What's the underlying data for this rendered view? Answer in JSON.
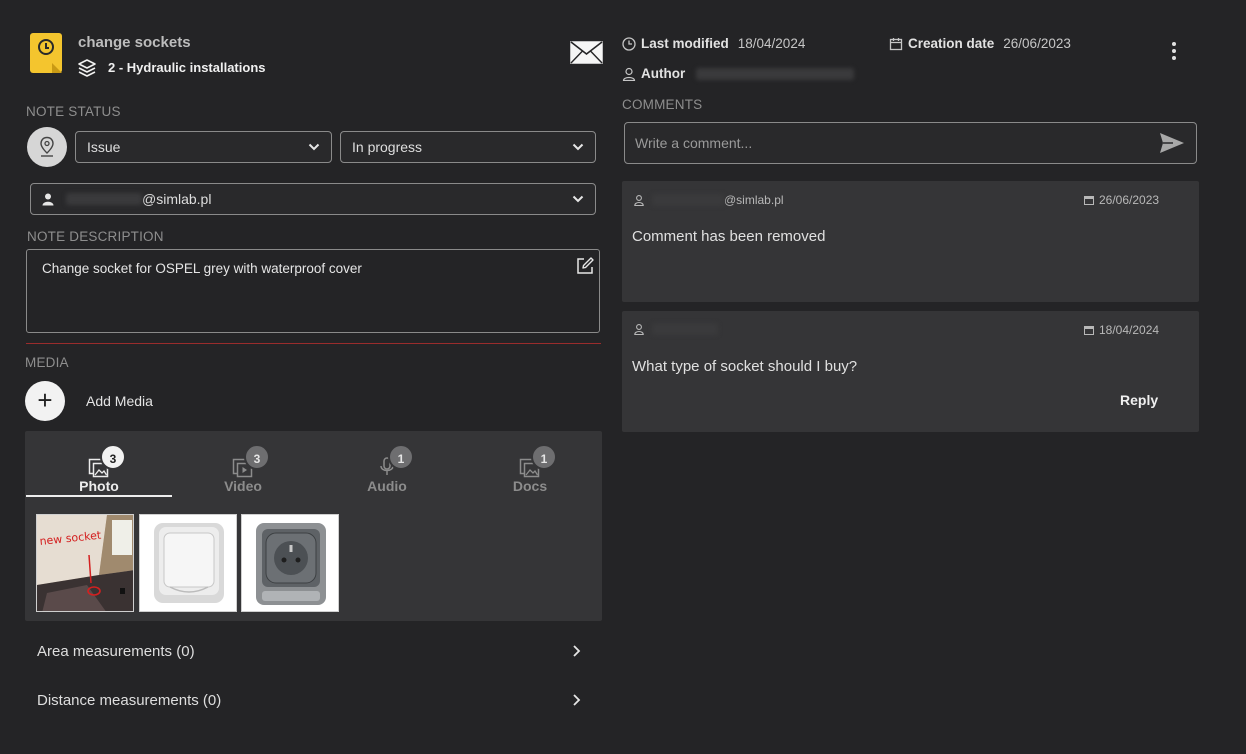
{
  "header": {
    "title": "change sockets",
    "layer": "2 - Hydraulic installations",
    "last_modified_label": "Last modified",
    "last_modified_value": "18/04/2024",
    "creation_date_label": "Creation date",
    "creation_date_value": "26/06/2023",
    "author_label": "Author",
    "note_icon_color": "#f4c52e"
  },
  "status": {
    "section_label": "NOTE STATUS",
    "type_value": "Issue",
    "state_value": "In progress",
    "assignee_suffix": "@simlab.pl"
  },
  "description": {
    "section_label": "NOTE DESCRIPTION",
    "text": "Change socket for OSPEL grey with waterproof cover",
    "divider_color": "#9a2c2c"
  },
  "media": {
    "section_label": "MEDIA",
    "add_label": "Add Media",
    "tabs": [
      {
        "label": "Photo",
        "count": "3",
        "icon": "photo-icon"
      },
      {
        "label": "Video",
        "count": "3",
        "icon": "video-icon"
      },
      {
        "label": "Audio",
        "count": "1",
        "icon": "microphone-icon"
      },
      {
        "label": "Docs",
        "count": "1",
        "icon": "document-icon"
      }
    ],
    "active_tab": "Photo",
    "thumbnails": [
      "wall-socket-photo",
      "closed-socket-cover",
      "open-socket-cover"
    ],
    "thumb_annotation": "new socket"
  },
  "measurements": {
    "area": "Area measurements (0)",
    "distance": "Distance measurements (0)"
  },
  "comments": {
    "section_label": "COMMENTS",
    "placeholder": "Write a comment...",
    "items": [
      {
        "user_suffix": "@simlab.pl",
        "date": "26/06/2023",
        "text": "Comment has been removed"
      },
      {
        "user_suffix": "",
        "date": "18/04/2024",
        "text": "What type of socket should I buy?",
        "reply_label": "Reply"
      }
    ]
  }
}
